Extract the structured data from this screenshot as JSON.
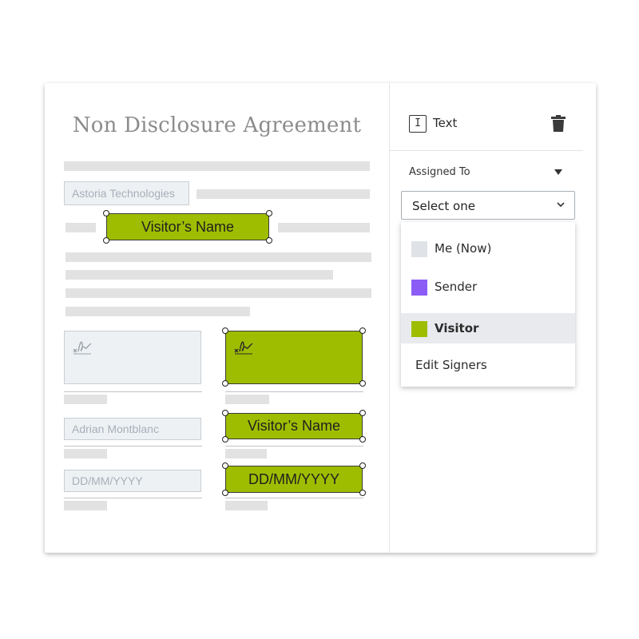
{
  "document": {
    "title": "Non Disclosure Agreement",
    "company_field": "Astoria Technologies",
    "visitor_name_inline": "Visitor’s Name",
    "sender_name_field": "Adrian Montblanc",
    "sender_date_field": "DD/MM/YYYY",
    "visitor_name_field": "Visitor’s Name",
    "visitor_date_field": "DD/MM/YYYY"
  },
  "panel": {
    "field_type": "Text",
    "assigned_to_label": "Assigned To",
    "select_value": "Select one",
    "options": [
      {
        "label": "Me (Now)",
        "color": "#dfe3e8"
      },
      {
        "label": "Sender",
        "color": "#8b5cf6"
      },
      {
        "label": "Visitor",
        "color": "#9fbd00",
        "selected": true
      }
    ],
    "edit_signers": "Edit Signers"
  },
  "colors": {
    "visitor_green": "#9fbd00",
    "placeholder_bg": "#eef1f4"
  },
  "icons": [
    "text-field-icon",
    "trash-icon",
    "caret-down-icon",
    "chevron-down-icon",
    "signature-icon"
  ]
}
